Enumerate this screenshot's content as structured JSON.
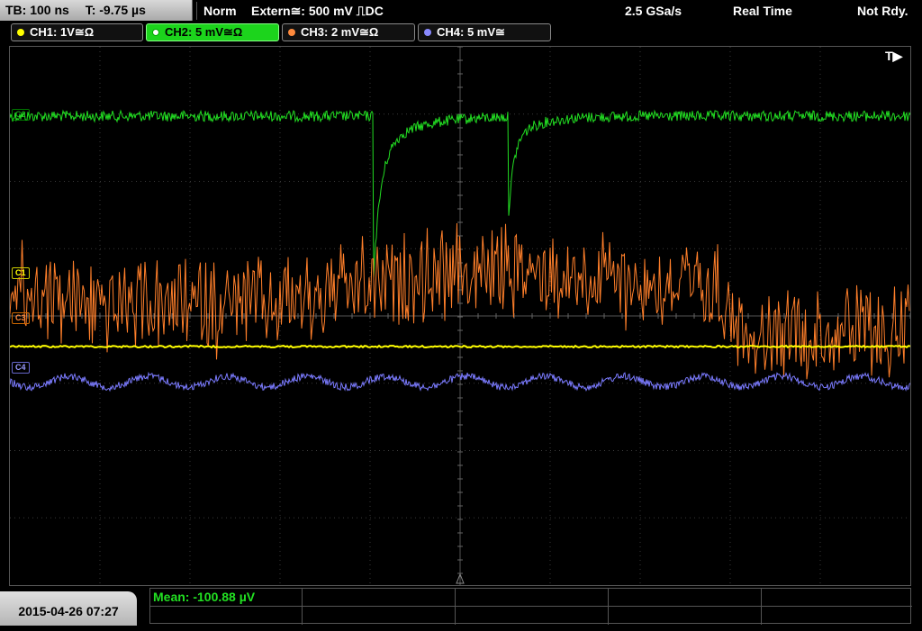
{
  "topbar": {
    "timebase": "TB: 100 ns",
    "trigger_time": "T: -9.75 µs",
    "mode": "Norm",
    "trigger_source": "Extern≅: 500 mV ⎍DC",
    "sample_rate": "2.5 GSa/s",
    "acq_mode": "Real Time",
    "state": "Not Rdy."
  },
  "channels": [
    {
      "label": "CH1: 1V≅Ω",
      "color": "#ffff00",
      "active": false
    },
    {
      "label": "CH2: 5 mV≅Ω",
      "color": "#22dd22",
      "active": true
    },
    {
      "label": "CH3: 2 mV≅Ω",
      "color": "#ff8a3d",
      "active": false
    },
    {
      "label": "CH4: 5 mV≅",
      "color": "#8a8aff",
      "active": false
    }
  ],
  "trigger_marker": "T▶",
  "markers": {
    "c1": "C1",
    "c3": "C3",
    "c4": "C4",
    "c2": "C2"
  },
  "colors": {
    "ch1": "#ffff00",
    "ch2": "#22dd22",
    "ch3": "#ff7f2a",
    "ch4": "#7b7bff",
    "grid": "#3a3a3a"
  },
  "bottom": {
    "datetime": "2015-04-26 07:27",
    "measurement": "Mean: -100.88 µV"
  }
}
